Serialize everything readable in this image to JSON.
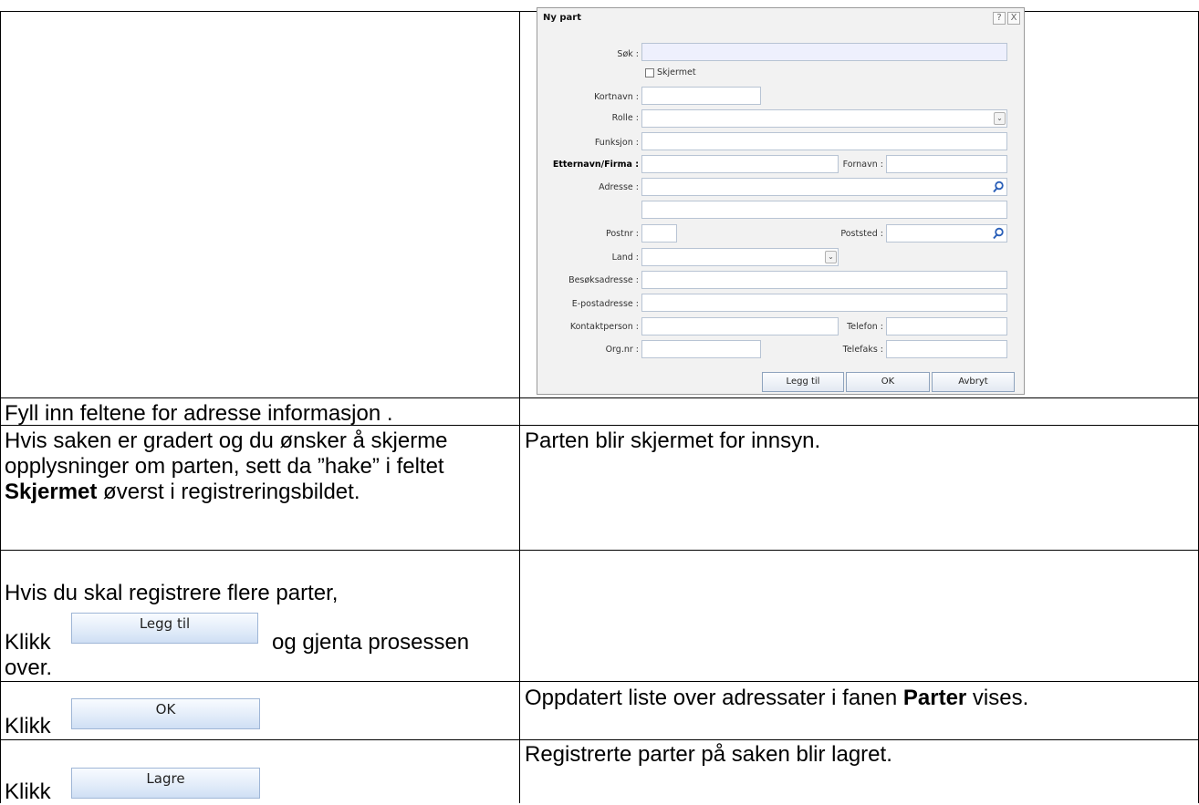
{
  "dialog": {
    "title": "Ny part",
    "help_btn": "?",
    "close_btn": "X",
    "labels": {
      "sok": "Søk :",
      "skjermet": "Skjermet",
      "kortnavn": "Kortnavn :",
      "rolle": "Rolle :",
      "funksjon": "Funksjon :",
      "etternavn": "Etternavn/Firma :",
      "fornavn": "Fornavn :",
      "adresse": "Adresse :",
      "postnr": "Postnr :",
      "poststed": "Poststed :",
      "land": "Land :",
      "besoksadresse": "Besøksadresse :",
      "epost": "E-postadresse :",
      "kontaktperson": "Kontaktperson :",
      "telefon": "Telefon :",
      "orgnr": "Org.nr :",
      "telefaks": "Telefaks :"
    },
    "buttons": {
      "legg_til": "Legg til",
      "ok": "OK",
      "avbryt": "Avbryt"
    }
  },
  "rows": {
    "r1_left": "Fyll inn feltene for adresse informasjon .",
    "r2_left_a": "Hvis saken er gradert og du ønsker å skjerme opplysninger om parten, sett da ”hake” i feltet ",
    "r2_left_bold": "Skjermet",
    "r2_left_b": " øverst i registreringsbildet.",
    "r2_right": "Parten blir skjermet for innsyn.",
    "r3_left_line1": "Hvis du skal registrere flere parter,",
    "r3_klikk": "Klikk",
    "r3_button": "Legg til",
    "r3_after": "og gjenta prosessen",
    "r3_after2": "over.",
    "r4_klikk": "Klikk",
    "r4_button": "OK",
    "r4_right_a": "Oppdatert liste over adressater i fanen ",
    "r4_right_bold": "Parter",
    "r4_right_b": " vises.",
    "r5_klikk": "Klikk",
    "r5_button": "Lagre",
    "r5_right": "Registrerte parter på saken blir lagret."
  }
}
